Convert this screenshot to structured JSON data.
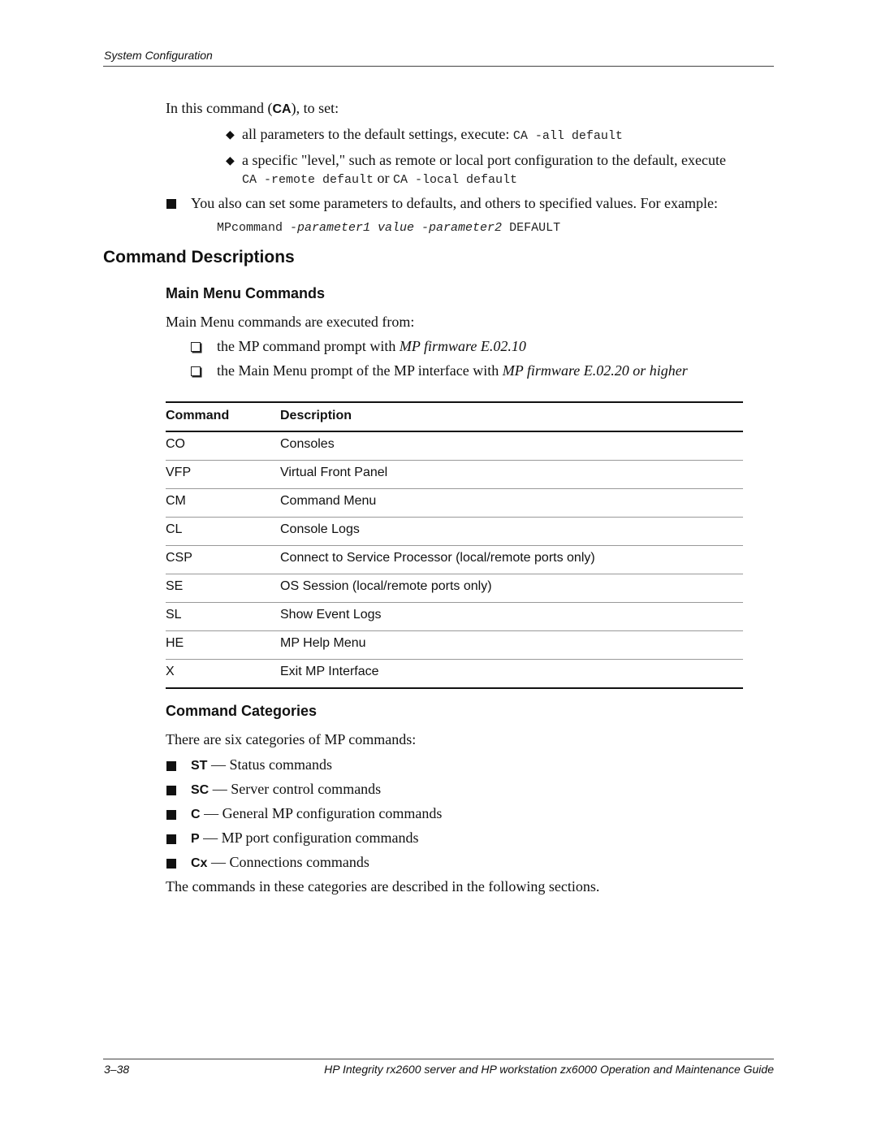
{
  "header": {
    "running_head": "System Configuration"
  },
  "intro": {
    "lead_pre": "In this command (",
    "lead_cmd": "CA",
    "lead_post": "), to set:",
    "bullets": [
      {
        "text": "all parameters to the default settings, execute: ",
        "code": "CA -all default"
      },
      {
        "text": "a specific \"level,\" such as remote or local port configuration to the default, execute",
        "code1": "CA -remote default",
        "or": "or",
        "code2": "CA -local default"
      }
    ],
    "also": "You also can set some parameters to defaults, and others to specified values. For example:",
    "example": {
      "cmd": "MPcommand ",
      "p1": "-parameter1 value -parameter2",
      "tail": " DEFAULT"
    }
  },
  "section": {
    "title": "Command Descriptions",
    "main_menu": {
      "title": "Main Menu Commands",
      "lead": "Main Menu commands are executed from:",
      "items": [
        {
          "text": "the MP command prompt with ",
          "italic": "MP firmware E.02.10"
        },
        {
          "text": "the Main Menu prompt of the MP interface with ",
          "italic": "MP firmware E.02.20 or higher"
        }
      ]
    },
    "table": {
      "headers": [
        "Command",
        "Description"
      ],
      "rows": [
        [
          "CO",
          "Consoles"
        ],
        [
          "VFP",
          "Virtual Front Panel"
        ],
        [
          "CM",
          "Command Menu"
        ],
        [
          "CL",
          "Console Logs"
        ],
        [
          "CSP",
          "Connect to Service Processor (local/remote ports only)"
        ],
        [
          "SE",
          "OS Session (local/remote ports only)"
        ],
        [
          "SL",
          "Show Event Logs"
        ],
        [
          "HE",
          "MP Help Menu"
        ],
        [
          "X",
          "Exit MP Interface"
        ]
      ]
    },
    "categories": {
      "title": "Command Categories",
      "lead": "There are six categories of MP commands:",
      "items": [
        {
          "code": "ST",
          "text": " — Status commands"
        },
        {
          "code": "SC",
          "text": " — Server control commands"
        },
        {
          "code": "C",
          "text": " — General MP configuration commands"
        },
        {
          "code": "P",
          "text": " — MP port configuration commands"
        },
        {
          "code": "Cx",
          "text": " — Connections commands"
        }
      ],
      "closing": "The commands in these categories are described in the following sections."
    }
  },
  "footer": {
    "page": "3–38",
    "title": "HP Integrity rx2600 server and HP workstation zx6000 Operation and Maintenance Guide"
  }
}
